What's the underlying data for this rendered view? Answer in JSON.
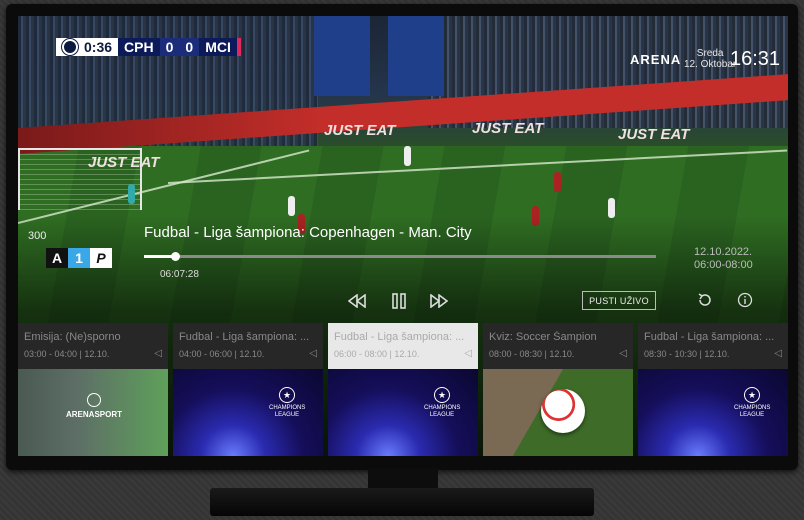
{
  "scoreboard": {
    "match_time": "0:36",
    "home_team": "CPH",
    "home_score": "0",
    "away_score": "0",
    "away_team": "MCI"
  },
  "header": {
    "brand": "ARENA",
    "day": "Sreda",
    "date": "12. Oktobar",
    "clock": "16:31"
  },
  "player": {
    "channel_number": "300",
    "channel_logo": [
      "A",
      "1",
      "P"
    ],
    "title": "Fudbal - Liga šampiona: Copenhagen - Man. City",
    "elapsed": "06:07:28",
    "progress": 0.06,
    "air_date": "12.10.2022.",
    "air_time": "06:00-08:00",
    "live_button": "PUSTI UŽIVO",
    "icons": {
      "rewind": "rewind-icon",
      "pause": "pause-icon",
      "forward": "fast-forward-icon",
      "restart": "restart-icon",
      "info": "info-icon"
    }
  },
  "carousel": [
    {
      "title": "Emisija: (Ne)sporno",
      "time": "03:00 - 04:00 | 12.10.",
      "thumb": "arena-sport"
    },
    {
      "title": "Fudbal - Liga šampiona: ...",
      "time": "04:00 - 06:00 | 12.10.",
      "thumb": "champions-league"
    },
    {
      "title": "Fudbal - Liga šampiona: ...",
      "time": "06:00 - 08:00 | 12.10.",
      "thumb": "champions-league",
      "selected": true
    },
    {
      "title": "Kviz: Soccer Šampion",
      "time": "08:00 - 08:30 | 12.10.",
      "thumb": "soccer-ball"
    },
    {
      "title": "Fudbal - Liga šampiona: ...",
      "time": "08:30 - 10:30 | 12.10.",
      "thumb": "champions-league"
    }
  ],
  "scene_text": {
    "ad_board": "JUST EAT",
    "ucl_banner": "CHAMPIONS LEAGUE",
    "arena_logo": "ARENASPORT"
  },
  "colors": {
    "selection_outline": "#e03030",
    "channel_one_blue": "#3aa8e6",
    "scoreboard_navy": "#0d1a5a",
    "scoreboard_accent": "#e0285a"
  }
}
